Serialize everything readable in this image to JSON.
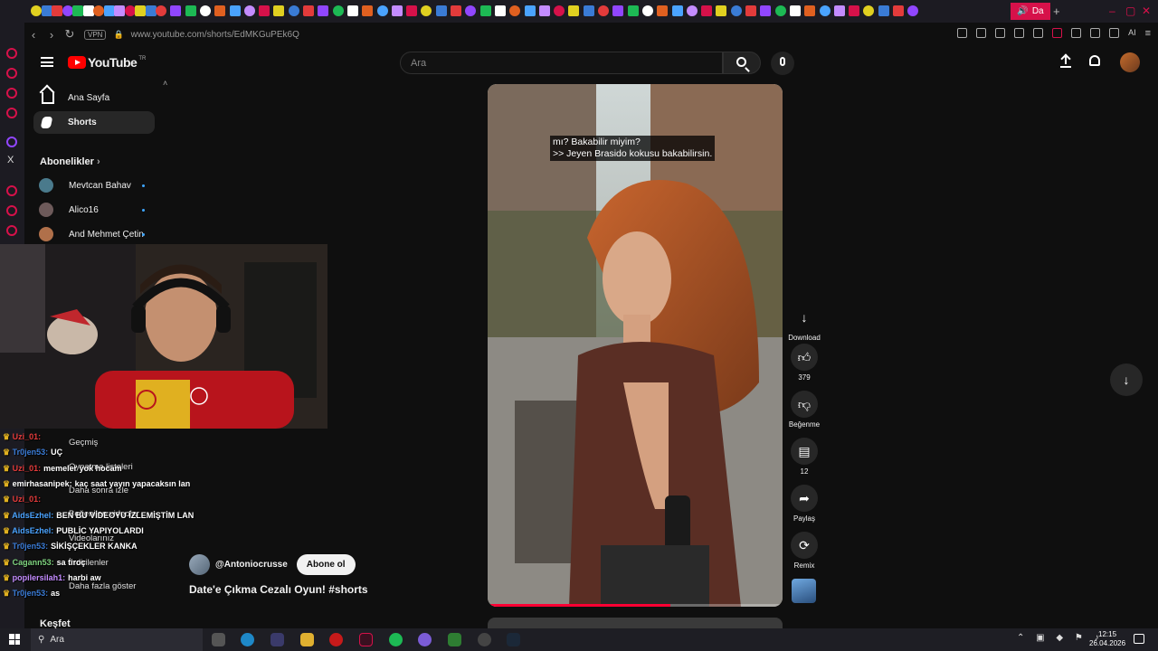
{
  "browser": {
    "url": "www.youtube.com/shorts/EdMKGuPEk6Q",
    "vpn_label": "VPN",
    "active_tab_label": "Da",
    "ai_label": "AI"
  },
  "youtube": {
    "logo_text": "YouTube",
    "logo_region": "TR",
    "search_placeholder": "Ara"
  },
  "guide": {
    "main_items": [
      {
        "label": "Ana Sayfa",
        "icon": "home-icon"
      },
      {
        "label": "Shorts",
        "icon": "shorts-icon",
        "active": true
      }
    ],
    "subscriptions_title": "Abonelikler",
    "subscriptions": [
      {
        "name": "Mevtcan Bahav"
      },
      {
        "name": "Alico16"
      },
      {
        "name": "And Mehmet Çetin"
      }
    ],
    "you_items": [
      {
        "label": "Geçmiş"
      },
      {
        "label": "Oynatma listeleri"
      },
      {
        "label": "Daha sonra izle"
      },
      {
        "label": "Beğenilen videolar"
      },
      {
        "label": "Videolarınız"
      },
      {
        "label": "İndirilenler"
      },
      {
        "label": "Daha fazla göster"
      }
    ],
    "explore_title": "Keşfet"
  },
  "chat": [
    {
      "user": "Uzi_01:",
      "msg": "",
      "color": "#e33b3b"
    },
    {
      "user": "Tr0jen53:",
      "msg": "UÇ",
      "color": "#3a7bd5"
    },
    {
      "user": "Uzi_01:",
      "msg": "memeler yok hocam",
      "color": "#e33b3b"
    },
    {
      "user": "emirhasanipek:",
      "msg": "kaç saat yayın yapacaksın lan",
      "color": "#ffffff"
    },
    {
      "user": "Uzi_01:",
      "msg": "",
      "color": "#e33b3b"
    },
    {
      "user": "AidsEzhel:",
      "msg": "BEN BU VİDEOYU İZLEMİŞTİM LAN",
      "color": "#4aa3ff"
    },
    {
      "user": "AidsEzhel:",
      "msg": "PUBLİC YAPIYOLARDI",
      "color": "#4aa3ff"
    },
    {
      "user": "Tr0jen53:",
      "msg": "SİKİŞÇEKLER KANKA",
      "color": "#3a7bd5"
    },
    {
      "user": "Cagann53:",
      "msg": "sa tiroç",
      "color": "#7fd47f"
    },
    {
      "user": "popilersilah1:",
      "msg": "harbi aw",
      "color": "#c48cff"
    },
    {
      "user": "Tr0jen53:",
      "msg": "as",
      "color": "#3a7bd5"
    }
  ],
  "short": {
    "caption_line1": "mı? Bakabilir miyim?",
    "caption_line2": ">> Jeyen Brasido kokusu bakabilirsin.",
    "channel": "@Antoniocrusse",
    "subscribe_label": "Abone ol",
    "title": "Date'e Çıkma Cezalı Oyun! #shorts",
    "progress": 0.62
  },
  "actions": {
    "download_label": "Download",
    "like_count": "379",
    "dislike_label": "Beğenme",
    "comment_count": "12",
    "share_label": "Paylaş",
    "remix_label": "Remix"
  },
  "taskbar": {
    "search_label": "Ara",
    "time": "12:15",
    "date": "26.04.2026"
  },
  "colors": {
    "accent": "#d6114a",
    "youtube_red": "#ff0000",
    "background": "#0f0f0f"
  }
}
